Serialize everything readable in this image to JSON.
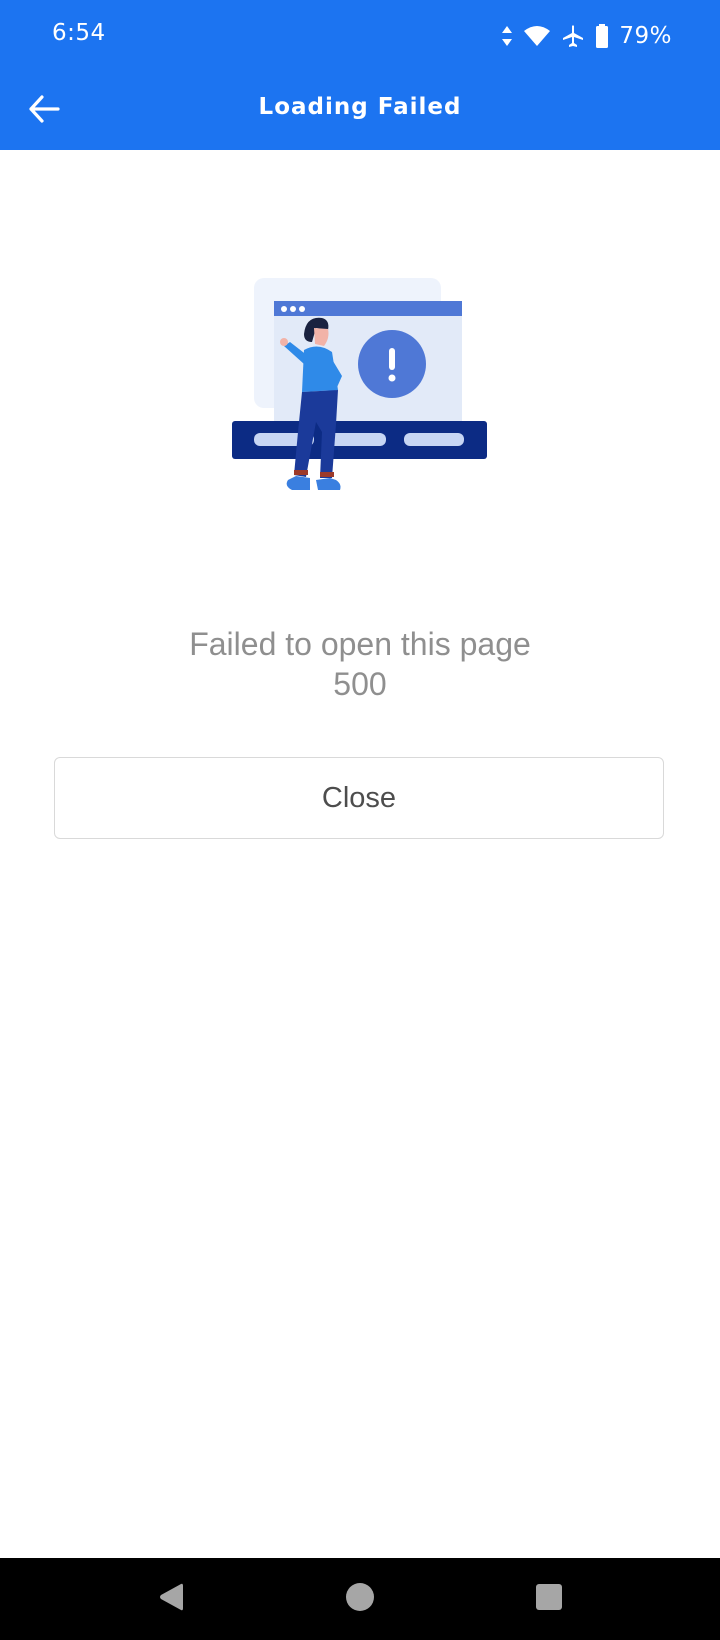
{
  "status_bar": {
    "time": "6:54",
    "battery_percent": "79%",
    "icons": [
      "data-arrows-icon",
      "wifi-icon",
      "airplane-mode-icon",
      "battery-icon"
    ]
  },
  "app_bar": {
    "title": "Loading Failed",
    "back_icon": "arrow-left-icon"
  },
  "error": {
    "message": "Failed to open this page",
    "code": "500"
  },
  "actions": {
    "close_label": "Close"
  },
  "nav_bar": {
    "icons": [
      "nav-back-icon",
      "nav-home-icon",
      "nav-recents-icon"
    ]
  },
  "colors": {
    "accent": "#1c74f1",
    "message_text": "#8f8f8f",
    "button_text": "#4d4d4d",
    "button_border": "#d9d9d9",
    "illustration_dark": "#0c2b84",
    "illustration_mid": "#4f78d6",
    "illustration_light": "#e6ecf8"
  }
}
